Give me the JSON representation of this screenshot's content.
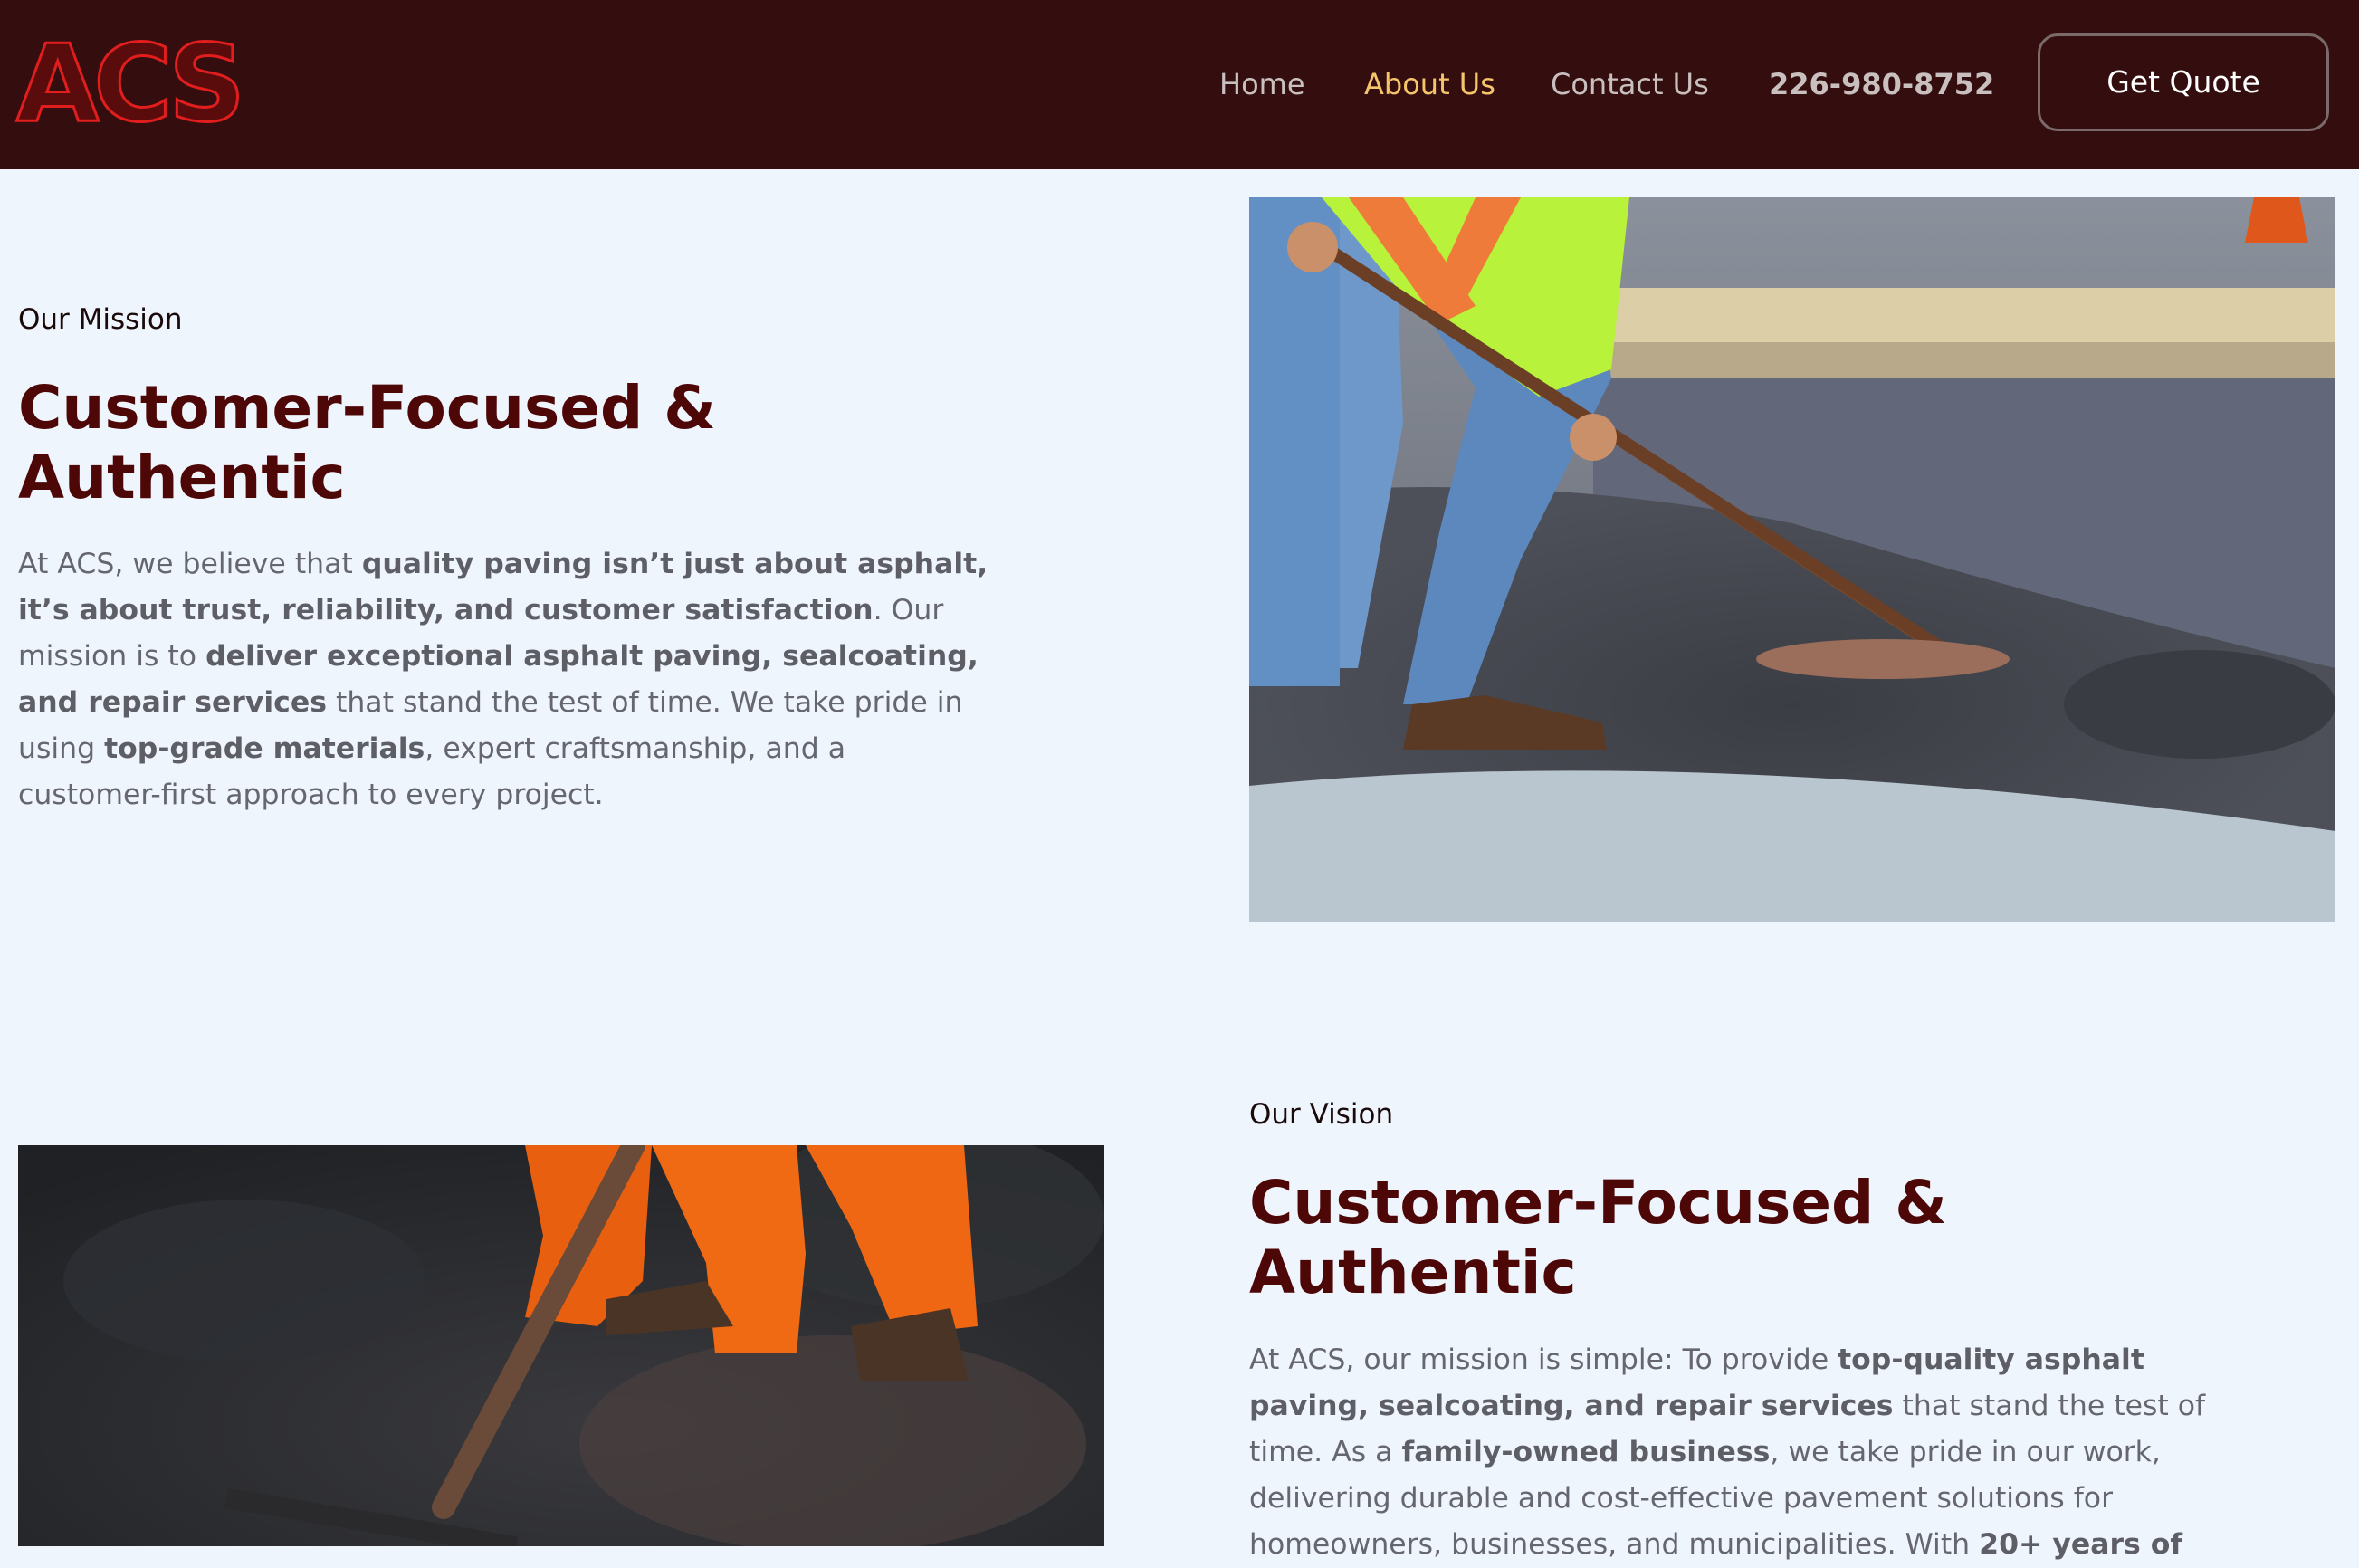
{
  "brand": {
    "logo_text": "ACS",
    "accent_color": "#e11d1d",
    "header_bg": "#340e0f"
  },
  "nav": {
    "items": [
      {
        "label": "Home",
        "active": false
      },
      {
        "label": "About Us",
        "active": true
      },
      {
        "label": "Contact Us",
        "active": false
      }
    ],
    "phone": "226-980-8752",
    "cta_label": "Get Quote",
    "active_color": "#f5c56b"
  },
  "mission": {
    "eyebrow": "Our Mission",
    "heading_line1": "Customer-Focused &",
    "heading_line2": "Authentic",
    "para": [
      [
        "At ACS, we believe that ",
        "quality paving isn’t just about asphalt,"
      ],
      [
        "it’s about trust, reliability, and customer satisfaction",
        ". Our"
      ],
      [
        "mission is to ",
        "deliver exceptional asphalt paving, sealcoating,"
      ],
      [
        "and repair services",
        " that stand the test of time. We take pride in"
      ],
      [
        "using ",
        "top-grade materials",
        ", expert craftsmanship, and a"
      ],
      [
        "customer-first approach to every project."
      ]
    ],
    "image_icon": "worker-raking-asphalt-photo"
  },
  "vision": {
    "eyebrow": "Our Vision",
    "heading_line1": "Customer-Focused &",
    "heading_line2": "Authentic",
    "para": [
      [
        "At ACS, our mission is simple: To provide ",
        "top-quality asphalt"
      ],
      [
        "paving, sealcoating, and repair services",
        " that stand the test of"
      ],
      [
        "time. As a ",
        "family-owned business",
        ", we take pride in our work,"
      ],
      [
        "delivering durable and cost-effective pavement solutions for"
      ],
      [
        "homeowners, businesses, and municipalities. With ",
        "20+ years of"
      ]
    ],
    "image_icon": "asphalt-rake-closeup-photo"
  }
}
